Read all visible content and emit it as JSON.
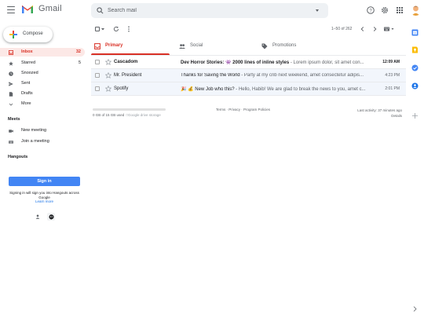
{
  "header": {
    "logo_text": "Gmail",
    "search_placeholder": "Search mail"
  },
  "compose": {
    "label": "Compose"
  },
  "nav": {
    "items": [
      {
        "label": "Inbox",
        "count": "32",
        "icon": "inbox-icon",
        "active": true
      },
      {
        "label": "Starred",
        "count": "5",
        "icon": "star-icon",
        "active": false
      },
      {
        "label": "Snoozed",
        "count": "",
        "icon": "clock-icon",
        "active": false
      },
      {
        "label": "Sent",
        "count": "",
        "icon": "send-icon",
        "active": false
      },
      {
        "label": "Drafts",
        "count": "",
        "icon": "draft-icon",
        "active": false
      },
      {
        "label": "More",
        "count": "",
        "icon": "chevron-down-icon",
        "active": false
      }
    ]
  },
  "meet": {
    "title": "Meets",
    "items": [
      {
        "label": "New meeting",
        "icon": "video-camera-icon"
      },
      {
        "label": "Join a meeting",
        "icon": "keyboard-icon"
      }
    ]
  },
  "hangouts": {
    "title": "Hangouts",
    "signin_label": "Sign in",
    "note": "Signing in will sign you into Hangouts across Google",
    "learn_more": "Learn more"
  },
  "toolbar": {
    "pagination": "1–50 of 262"
  },
  "tabs": [
    {
      "label": "Primary",
      "icon": "inbox-tab-icon",
      "active": true
    },
    {
      "label": "Social",
      "icon": "people-icon",
      "active": false
    },
    {
      "label": "Promotions",
      "icon": "tag-icon",
      "active": false
    }
  ],
  "emails": [
    {
      "sender": "Cascadom",
      "subject": "Dev Horror Stories: 👾 2000 lines of inline styles",
      "snippet": " - Lorem ipsum dolor, sit amet con...",
      "time": "12:09 AM",
      "unread": true
    },
    {
      "sender": "Mr. President",
      "subject": "Thanks for Saving the World",
      "snippet": " - Party at my crib next weekend, amet consectetur adipis...",
      "time": "4:23 PM",
      "unread": false
    },
    {
      "sender": "Spotify",
      "subject": "🎉 💰 New Job who this?",
      "snippet": " - Hello, Habib! We are glad to break the news to you, amet c...",
      "time": "2:01 PM",
      "unread": false
    }
  ],
  "footer": {
    "storage_text": "0 GB of 15 GB used",
    "storage_manage": "Google drive storage",
    "storage_fraction": 0.0,
    "links": [
      "Terms",
      "Privacy",
      "Program Policies"
    ],
    "link_sep": " · ",
    "activity_line1": "Last activity: 37 minutes ago",
    "activity_line2": "Details"
  },
  "colors": {
    "accent_red": "#d93025",
    "accent_blue": "#4285f4",
    "active_bg": "#fce8e6"
  }
}
